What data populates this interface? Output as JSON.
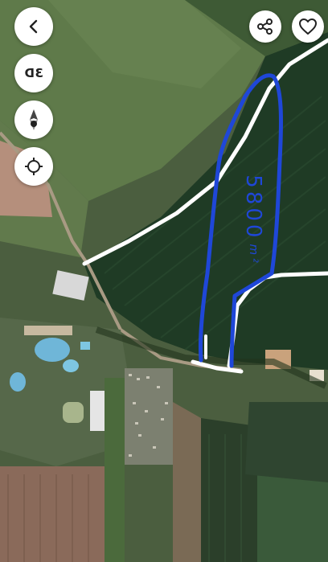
{
  "map": {
    "view": "satellite",
    "annotation": {
      "area_value": "5800",
      "area_unit": "m²",
      "stroke_color": "#1f47d8",
      "boundary_color": "#ffffff"
    }
  },
  "controls": {
    "back": {
      "icon": "chevron-left-icon"
    },
    "view_3d": {
      "label": "3D",
      "icon": "3d-icon"
    },
    "compass": {
      "icon": "compass-needle-icon"
    },
    "locate": {
      "icon": "locate-crosshair-icon"
    },
    "share": {
      "icon": "share-icon"
    },
    "favorite": {
      "icon": "heart-icon"
    }
  }
}
